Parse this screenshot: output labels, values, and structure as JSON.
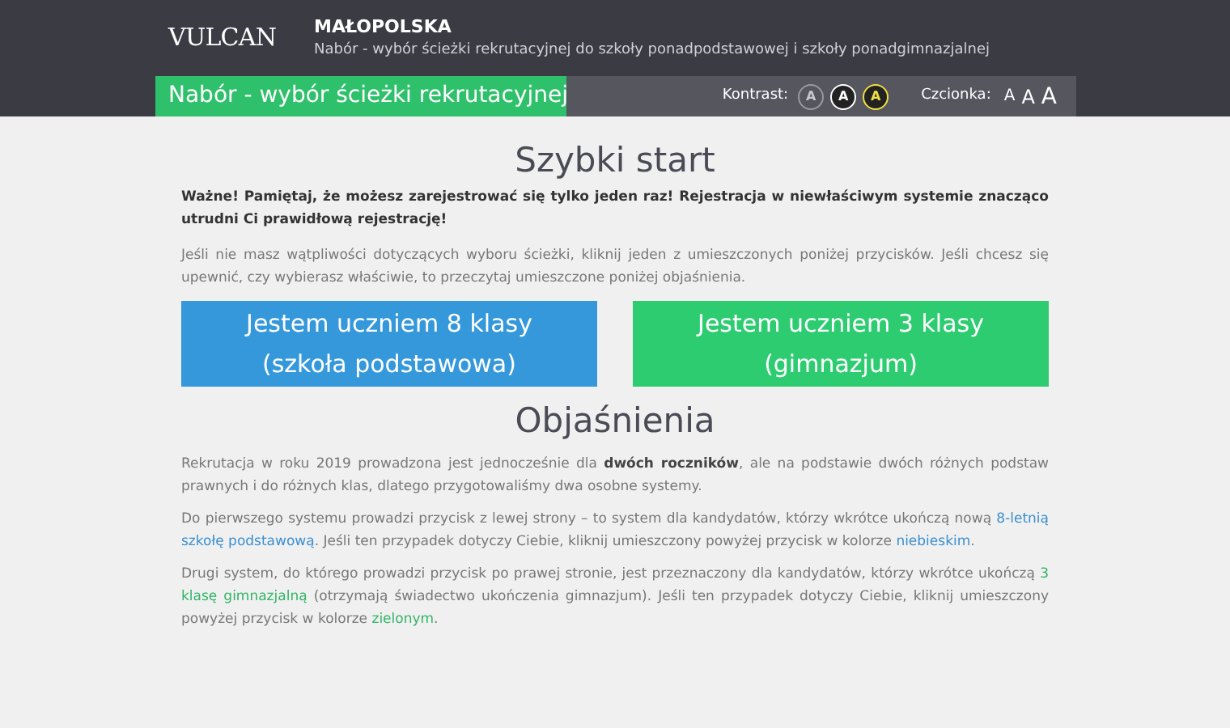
{
  "header": {
    "logo": "VULCAN",
    "region": "MAŁOPOLSKA",
    "subtitle": "Nabór - wybór ścieżki rekrutacyjnej do szkoły ponadpodstawowej i szkoły ponadgimnazjalnej"
  },
  "toolbar": {
    "title": "Nabór - wybór ścieżki rekrutacyjnej",
    "contrast_label": "Kontrast:",
    "contrast_buttons": [
      {
        "label": "A",
        "kind": "default"
      },
      {
        "label": "A",
        "kind": "inverse"
      },
      {
        "label": "A",
        "kind": "yellow"
      }
    ],
    "font_label": "Czcionka:",
    "font_buttons": [
      {
        "label": "A",
        "kind": "small"
      },
      {
        "label": "A",
        "kind": "medium"
      },
      {
        "label": "A",
        "kind": "large"
      }
    ]
  },
  "quick_start": {
    "heading": "Szybki start",
    "warning": "Ważne! Pamiętaj, że możesz zarejestrować się tylko jeden raz! Rejestracja w niewłaściwym systemie znacząco utrudni Ci prawidłową rejestrację!",
    "intro": "Jeśli nie masz wątpliwości dotyczących wyboru ścieżki, kliknij jeden z umieszczonych poniżej przycisków. Jeśli chcesz się upewnić, czy wybierasz właściwie, to przeczytaj umieszczone poniżej objaśnienia.",
    "buttons": [
      {
        "line1": "Jestem uczniem 8 klasy",
        "line2": "(szkoła podstawowa)",
        "color": "#3498db"
      },
      {
        "line1": "Jestem uczniem 3 klasy",
        "line2": "(gimnazjum)",
        "color": "#2ecc71"
      }
    ]
  },
  "explanations": {
    "heading": "Objaśnienia",
    "paragraphs": [
      [
        {
          "kind": "plain",
          "text": "Rekrutacja w roku 2019 prowadzona jest jednocześnie dla "
        },
        {
          "kind": "bold",
          "text": "dwóch roczników"
        },
        {
          "kind": "plain",
          "text": ", ale na podstawie dwóch różnych podstaw prawnych i do różnych klas, dlatego przygotowaliśmy dwa osobne systemy."
        }
      ],
      [
        {
          "kind": "plain",
          "text": "Do pierwszego systemu prowadzi przycisk z lewej strony – to system dla kandydatów, którzy wkrótce ukończą nową "
        },
        {
          "kind": "blue",
          "text": "8-letnią szkołę podstawową"
        },
        {
          "kind": "plain",
          "text": ". Jeśli ten przypadek dotyczy Ciebie, kliknij umieszczony powyżej przycisk w kolorze "
        },
        {
          "kind": "blue",
          "text": "niebieskim"
        },
        {
          "kind": "plain",
          "text": "."
        }
      ],
      [
        {
          "kind": "plain",
          "text": "Drugi system, do którego prowadzi przycisk po prawej stronie, jest przeznaczony dla kandydatów, którzy wkrótce ukończą "
        },
        {
          "kind": "green",
          "text": "3 klasę gimnazjalną"
        },
        {
          "kind": "plain",
          "text": " (otrzymają świadectwo ukończenia gimnazjum). Jeśli ten przypadek dotyczy Ciebie, kliknij umieszczony powyżej przycisk w kolorze "
        },
        {
          "kind": "green",
          "text": "zielonym"
        },
        {
          "kind": "plain",
          "text": "."
        }
      ]
    ]
  }
}
